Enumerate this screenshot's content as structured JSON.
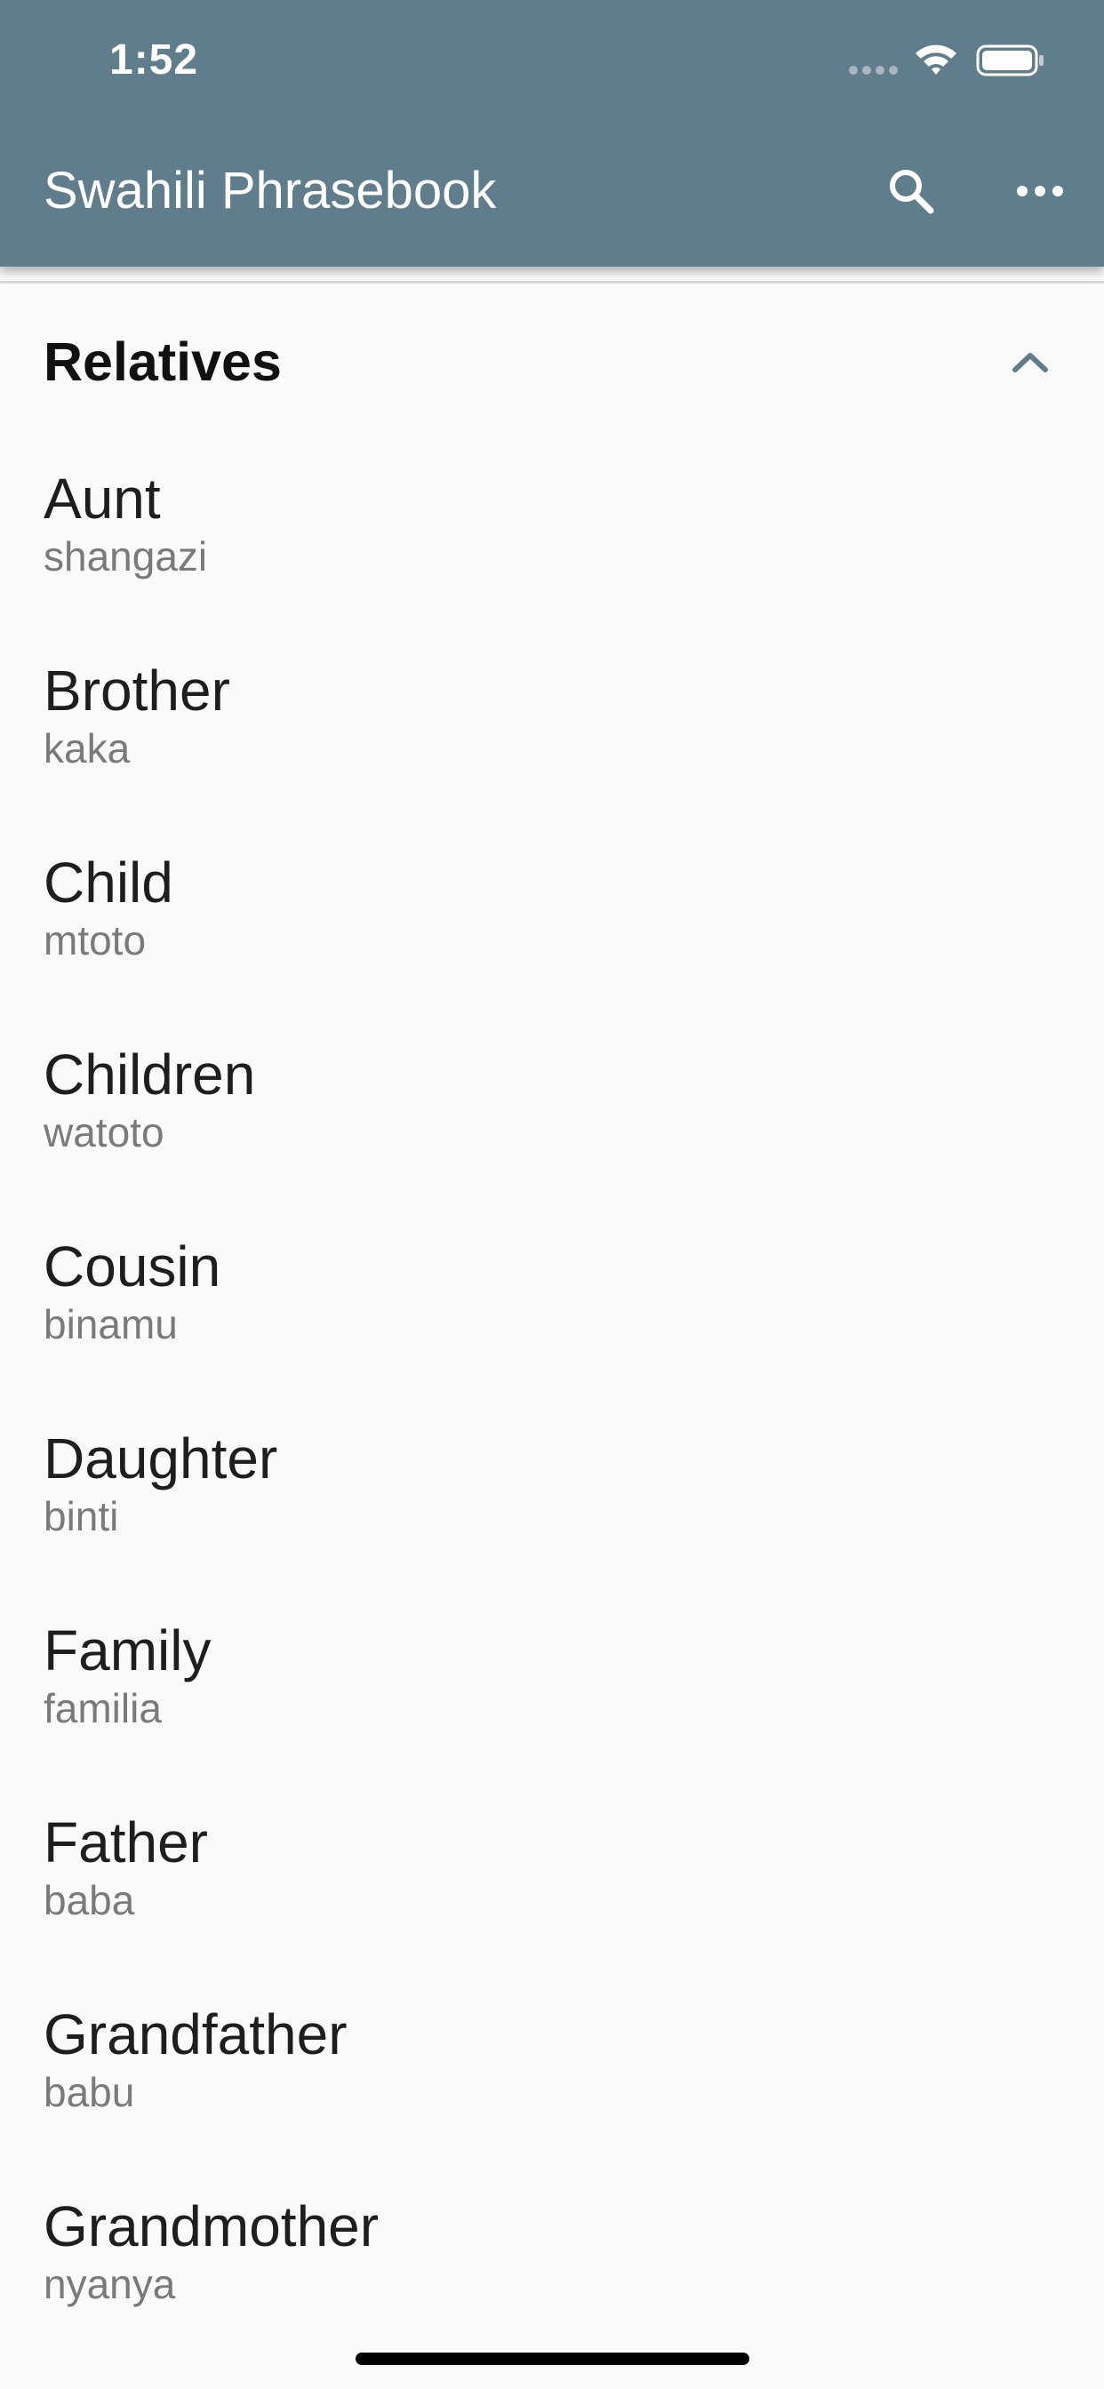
{
  "status_bar": {
    "time": "1:52"
  },
  "app_bar": {
    "title": "Swahili Phrasebook",
    "color": "#607d8b",
    "icons": [
      "search-icon",
      "more-horizontal-icon"
    ]
  },
  "section": {
    "title": "Relatives",
    "expanded": true,
    "icon": "chevron-up-icon"
  },
  "items": [
    {
      "english": "Aunt",
      "swahili": "shangazi"
    },
    {
      "english": "Brother",
      "swahili": "kaka"
    },
    {
      "english": "Child",
      "swahili": "mtoto"
    },
    {
      "english": "Children",
      "swahili": "watoto"
    },
    {
      "english": "Cousin",
      "swahili": "binamu"
    },
    {
      "english": "Daughter",
      "swahili": "binti"
    },
    {
      "english": "Family",
      "swahili": "familia"
    },
    {
      "english": "Father",
      "swahili": "baba"
    },
    {
      "english": "Grandfather",
      "swahili": "babu"
    },
    {
      "english": "Grandmother",
      "swahili": "nyanya"
    }
  ]
}
